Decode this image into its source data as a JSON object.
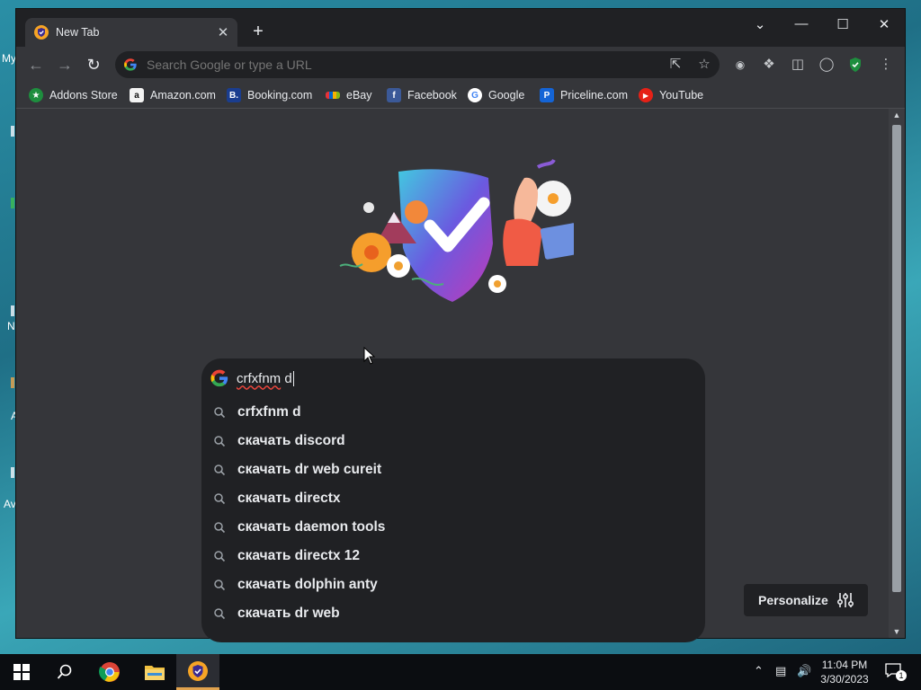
{
  "desktop": {
    "left_edge_labels": [
      "My",
      "N",
      "A",
      "A",
      "Av"
    ]
  },
  "browser": {
    "tab": {
      "title": "New Tab",
      "close_symbol": "✕"
    },
    "new_tab_symbol": "+",
    "window_controls": {
      "dropdown": "⌄",
      "minimize": "—",
      "maximize": "☐",
      "close": "✕"
    },
    "omnibox": {
      "placeholder": "Search Google or type a URL"
    },
    "bookmarks": [
      {
        "label": "Addons Store",
        "icon": "addons-store-icon",
        "color": "#1e8e3e",
        "glyph": "★"
      },
      {
        "label": "Amazon.com",
        "icon": "amazon-icon",
        "color": "#f3f3f3",
        "glyph": "a"
      },
      {
        "label": "Booking.com",
        "icon": "booking-icon",
        "color": "#1a3d8f",
        "glyph": "B."
      },
      {
        "label": "eBay",
        "icon": "ebay-icon",
        "color": "#2b2b2b",
        "glyph": "e"
      },
      {
        "label": "Facebook",
        "icon": "facebook-icon",
        "color": "#3b5998",
        "glyph": "f"
      },
      {
        "label": "Google",
        "icon": "google-icon",
        "color": "#ffffff",
        "glyph": "G"
      },
      {
        "label": "Priceline.com",
        "icon": "priceline-icon",
        "color": "#1464d6",
        "glyph": "P"
      },
      {
        "label": "YouTube",
        "icon": "youtube-icon",
        "color": "#e62117",
        "glyph": "▶"
      }
    ]
  },
  "search": {
    "typed_word": "crfxfnm",
    "typed_rest": " d",
    "suggestions": [
      "crfxfnm d",
      "скачать discord",
      "скачать dr web cureit",
      "скачать directx",
      "скачать daemon tools",
      "скачать directx 12",
      "скачать dolphin anty",
      "скачать dr web"
    ]
  },
  "personalize": {
    "label": "Personalize"
  },
  "taskbar": {
    "clock_time": "11:04 PM",
    "clock_date": "3/30/2023",
    "notification_count": "1"
  },
  "colors": {
    "window_bg": "#35363a",
    "titlebar_bg": "#202124",
    "accent_taskbar": "#e0a24e"
  }
}
